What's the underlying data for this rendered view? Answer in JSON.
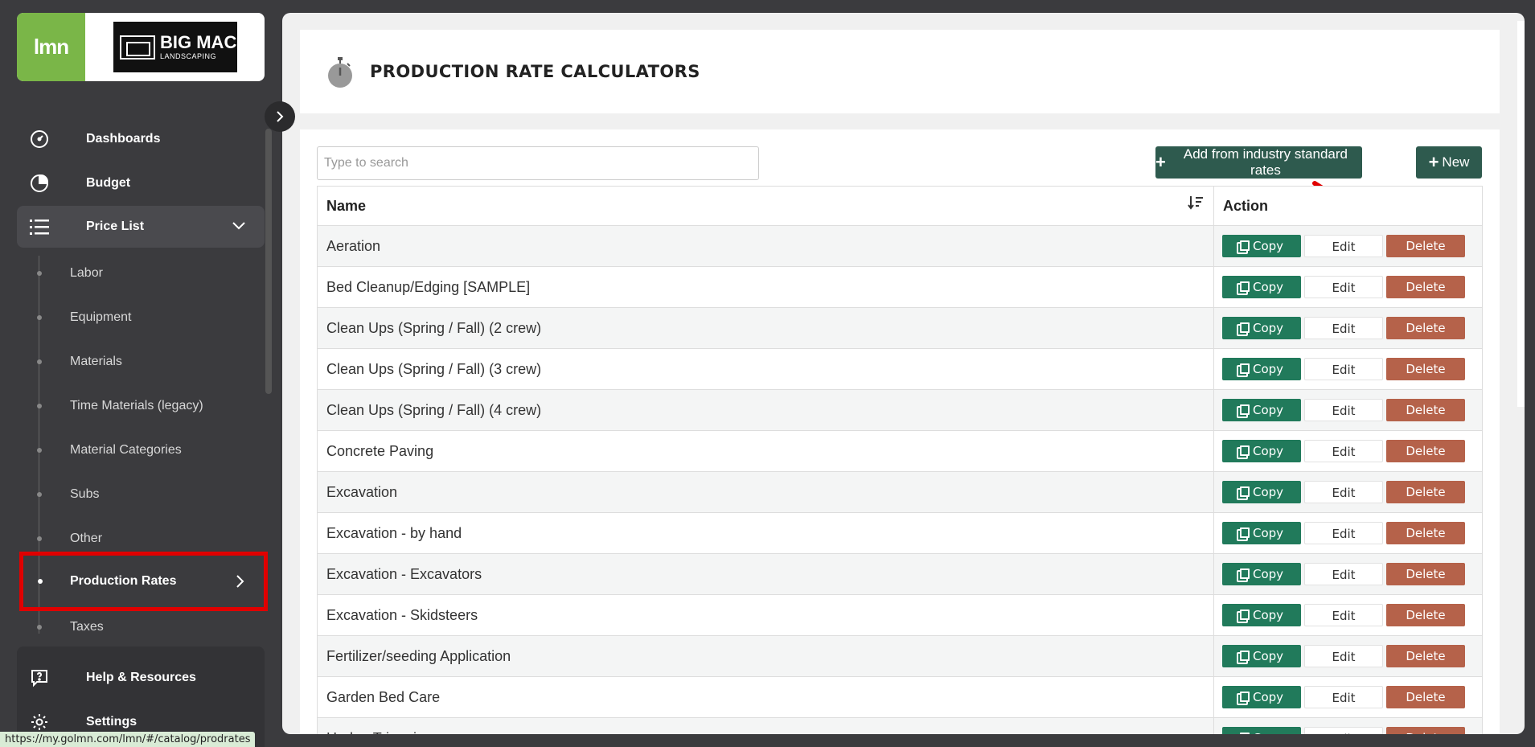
{
  "brand": {
    "lmn_logo": "lmn",
    "company_logo_line1": "BIG MAC",
    "company_logo_line2": "LANDSCAPING"
  },
  "sidebar": {
    "nav": [
      {
        "label": "Dashboards",
        "icon": "dashboard-gauge-icon"
      },
      {
        "label": "Budget",
        "icon": "pie-chart-icon"
      },
      {
        "label": "Price List",
        "icon": "list-icon"
      }
    ],
    "sub_items": [
      "Labor",
      "Equipment",
      "Materials",
      "Time Materials (legacy)",
      "Material Categories",
      "Subs",
      "Other",
      "Production Rates",
      "Taxes"
    ],
    "bottom": [
      {
        "label": "Help & Resources",
        "icon": "help-icon"
      },
      {
        "label": "Settings",
        "icon": "gear-icon"
      }
    ]
  },
  "status_bar": {
    "url": "https://my.golmn.com/lmn/#/catalog/prodrates"
  },
  "header": {
    "title": "PRODUCTION RATE CALCULATORS"
  },
  "toolbar": {
    "search_placeholder": "Type to search",
    "add_industry_label": "Add from industry standard rates",
    "new_label": "New"
  },
  "table": {
    "columns": [
      "Name",
      "Action"
    ],
    "actions": {
      "copy": "Copy",
      "edit": "Edit",
      "delete": "Delete"
    },
    "rows": [
      "Aeration",
      "Bed Cleanup/Edging [SAMPLE]",
      "Clean Ups (Spring / Fall) (2 crew)",
      "Clean Ups (Spring / Fall) (3 crew)",
      "Clean Ups (Spring / Fall) (4 crew)",
      "Concrete Paving",
      "Excavation",
      "Excavation - by hand",
      "Excavation - Excavators",
      "Excavation - Skidsteers",
      "Fertilizer/seeding Application",
      "Garden Bed Care",
      "Hedge Trimming"
    ]
  },
  "colors": {
    "sidebar_bg": "#3b3b3e",
    "lmn_green": "#7ab648",
    "primary_dark": "#2e5a4e",
    "copy_green": "#217a5b",
    "delete_red": "#b5624a",
    "highlight_red": "#e00000"
  }
}
